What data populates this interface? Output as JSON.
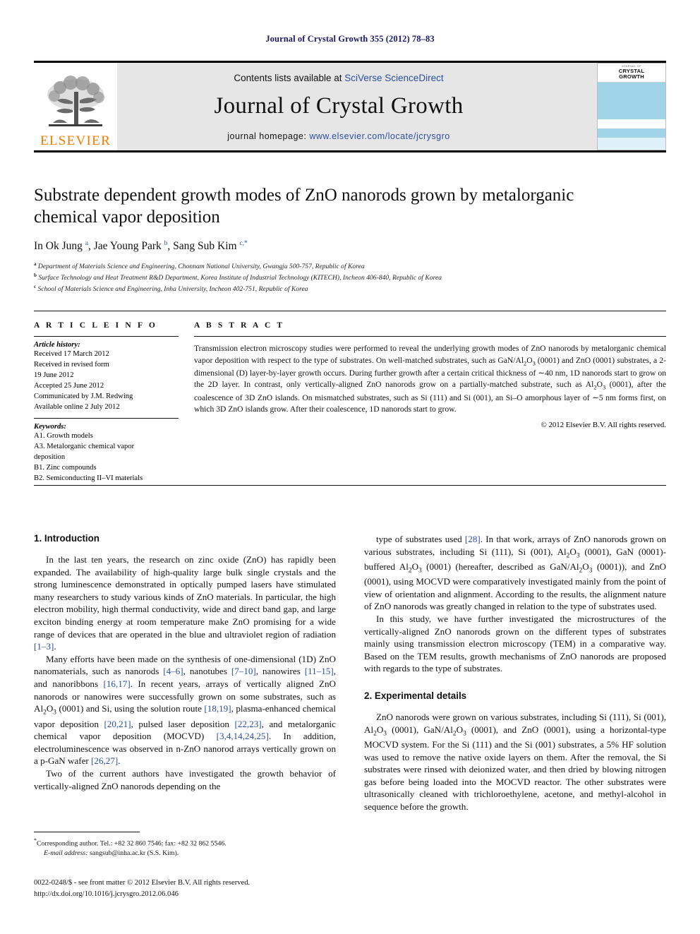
{
  "running_head": "Journal of Crystal Growth 355 (2012) 78–83",
  "masthead": {
    "contents_prefix": "Contents lists available at ",
    "contents_link": "SciVerse ScienceDirect",
    "journal_title": "Journal of Crystal Growth",
    "homepage_prefix": "journal homepage: ",
    "homepage_link": "www.elsevier.com/locate/jcrysgro",
    "publisher": "ELSEVIER",
    "cover": {
      "kicker": "JOURNAL OF",
      "line1": "CRYSTAL",
      "line2": "GROWTH"
    }
  },
  "article": {
    "title": "Substrate dependent growth modes of ZnO nanorods grown by metalorganic chemical vapor deposition",
    "authors_html": "In Ok Jung <sup>a</sup>, Jae Young Park <sup>b</sup>, Sang Sub Kim <sup>c,</sup><sup>*</sup>",
    "affiliations": [
      {
        "marker": "a",
        "text": "Department of Materials Science and Engineering, Chonnam National University, Gwangju 500-757, Republic of Korea"
      },
      {
        "marker": "b",
        "text": "Surface Technology and Heat Treatment R&D Department, Korea Institute of Industrial Technology (KITECH), Incheon 406-840, Republic of Korea"
      },
      {
        "marker": "c",
        "text": "School of Materials Science and Engineering, Inha University, Incheon 402-751, Republic of Korea"
      }
    ]
  },
  "article_info": {
    "heading": "A R T I C L E   I N F O",
    "history_label": "Article history:",
    "history_lines": [
      "Received 17 March 2012",
      "Received in revised form",
      "19 June 2012",
      "Accepted 25 June 2012",
      "Communicated by J.M. Redwing",
      "Available online 2 July 2012"
    ],
    "keywords_label": "Keywords:",
    "keywords": [
      "A1. Growth models",
      "A3. Metalorganic chemical vapor",
      "deposition",
      "B1. Zinc compounds",
      "B2. Semiconducting II–VI materials"
    ]
  },
  "abstract": {
    "heading": "A B S T R A C T",
    "text_html": "Transmission electron microscopy studies were performed to reveal the underlying growth modes of ZnO nanorods by metalorganic chemical vapor deposition with respect to the type of substrates. On well-matched substrates, such as GaN/Al<sub>2</sub>O<sub>3</sub> (0001) and ZnO (0001) substrates, a 2-dimensional (D) layer-by-layer growth occurs. During further growth after a certain critical thickness of ∼40 nm, 1D nanorods start to grow on the 2D layer. In contrast, only vertically-aligned ZnO nanorods grow on a partially-matched substrate, such as Al<sub>2</sub>O<sub>3</sub> (0001), after the coalescence of 3D ZnO islands. On mismatched substrates, such as Si (111) and Si (001), an Si–O amorphous layer of ∼5 nm forms first, on which 3D ZnO islands grow. After their coalescence, 1D nanorods start to grow.",
    "copyright": "© 2012 Elsevier B.V. All rights reserved."
  },
  "sections": {
    "intro_heading": "1.  Introduction",
    "experimental_heading": "2.  Experimental details"
  },
  "body": {
    "left": [
      "In the last ten years, the research on zinc oxide (ZnO) has rapidly been expanded. The availability of high-quality large bulk single crystals and the strong luminescence demonstrated in optically pumped lasers have stimulated many researchers to study various kinds of ZnO materials. In particular, the high electron mobility, high thermal conductivity, wide and direct band gap, and large exciton binding energy at room temperature make ZnO promising for a wide range of devices that are operated in the blue and ultraviolet region of radiation [1–3].",
      "Many efforts have been made on the synthesis of one-dimensional (1D) ZnO nanomaterials, such as nanorods [4–6], nanotubes [7–10], nanowires [11–15], and nanoribbons [16,17]. In recent years, arrays of vertically aligned ZnO nanorods or nanowires were successfully grown on some substrates, such as Al2O3 (0001) and Si, using the solution route [18,19], plasma-enhanced chemical vapor deposition [20,21], pulsed laser deposition [22,23], and metalorganic chemical vapor deposition (MOCVD) [3,4,14,24,25]. In addition, electroluminescence was observed in n-ZnO nanorod arrays vertically grown on a p-GaN wafer [26,27].",
      "Two of the current authors have investigated the growth behavior of vertically-aligned ZnO nanorods depending on the"
    ],
    "right": [
      "type of substrates used [28]. In that work, arrays of ZnO nanorods grown on various substrates, including Si (111), Si (001), Al2O3 (0001), GaN (0001)-buffered Al2O3 (0001) (hereafter, described as GaN/Al2O3 (0001)), and ZnO (0001), using MOCVD were comparatively investigated mainly from the point of view of orientation and alignment. According to the results, the alignment nature of ZnO nanorods was greatly changed in relation to the type of substrates used.",
      "In this study, we have further investigated the microstructures of the vertically-aligned ZnO nanorods grown on the different types of substrates mainly using transmission electron microscopy (TEM) in a comparative way. Based on the TEM results, growth mechanisms of ZnO nanorods are proposed with regards to the type of substrates.",
      "ZnO nanorods were grown on various substrates, including Si (111), Si (001), Al2O3 (0001), GaN/Al2O3 (0001), and ZnO (0001), using a horizontal-type MOCVD system. For the Si (111) and the Si (001) substrates, a 5% HF solution was used to remove the native oxide layers on them. After the removal, the Si substrates were rinsed with deionized water, and then dried by blowing nitrogen gas before being loaded into the MOCVD reactor. The other substrates were ultrasonically cleaned with trichloroethylene, acetone, and methyl-alcohol in sequence before the growth."
    ]
  },
  "footer": {
    "corresponding": "Corresponding author. Tel.: +82 32 860 7546; fax: +82 32 862 5546.",
    "email_label": "E-mail address:",
    "email": "sangsub@inha.ac.kr (S.S. Kim).",
    "issn_line": "0022-0248/$ - see front matter © 2012 Elsevier B.V. All rights reserved.",
    "doi_line": "http://dx.doi.org/10.1016/j.jcrysgro.2012.06.046"
  },
  "colors": {
    "link": "#2b4ea2",
    "elsevier_orange": "#f07c00",
    "masthead_bg": "#e6e6e6",
    "cover_blue": "#9fd4e8"
  }
}
